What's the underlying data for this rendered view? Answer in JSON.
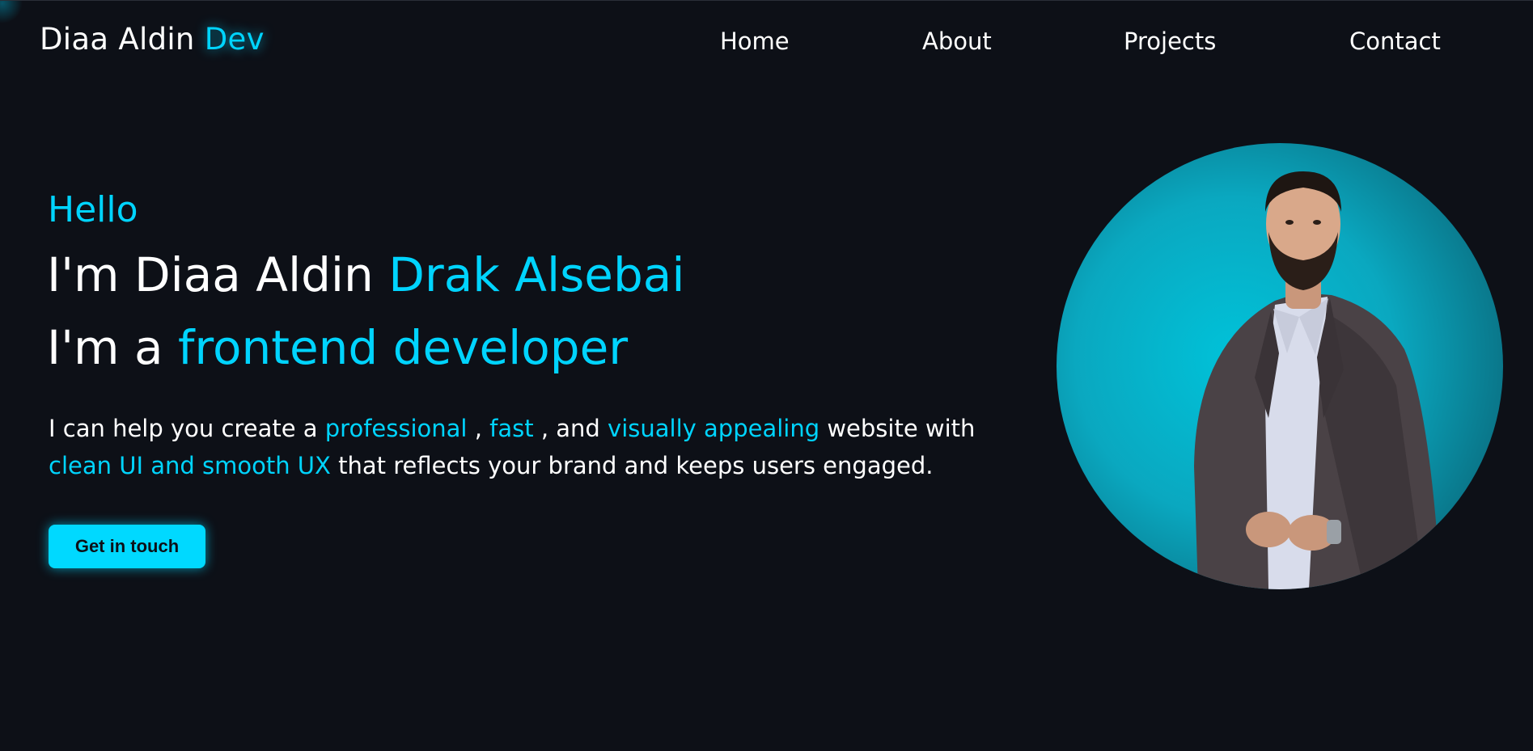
{
  "header": {
    "logo": {
      "name": "Diaa Aldin",
      "accent": "Dev"
    },
    "nav": [
      {
        "label": "Home"
      },
      {
        "label": "About"
      },
      {
        "label": "Projects"
      },
      {
        "label": "Contact"
      }
    ]
  },
  "hero": {
    "greeting": "Hello",
    "headline1": {
      "prefix": "I'm Diaa Aldin",
      "accent": "Drak Alsebai"
    },
    "headline2": {
      "prefix": "I'm a",
      "accent": "frontend developer"
    },
    "intro": {
      "t1": "I can help you create a",
      "h1": "professional",
      "t2": ",",
      "h2": "fast",
      "t3": ", and",
      "h3": "visually appealing",
      "t4": "website with",
      "h4": "clean UI and smooth UX",
      "t5": "that reflects your brand and keeps users engaged."
    },
    "cta_label": "Get in touch"
  },
  "colors": {
    "background": "#0d1017",
    "accent": "#00d4ff",
    "button": "#00d9ff",
    "text": "#ffffff"
  }
}
